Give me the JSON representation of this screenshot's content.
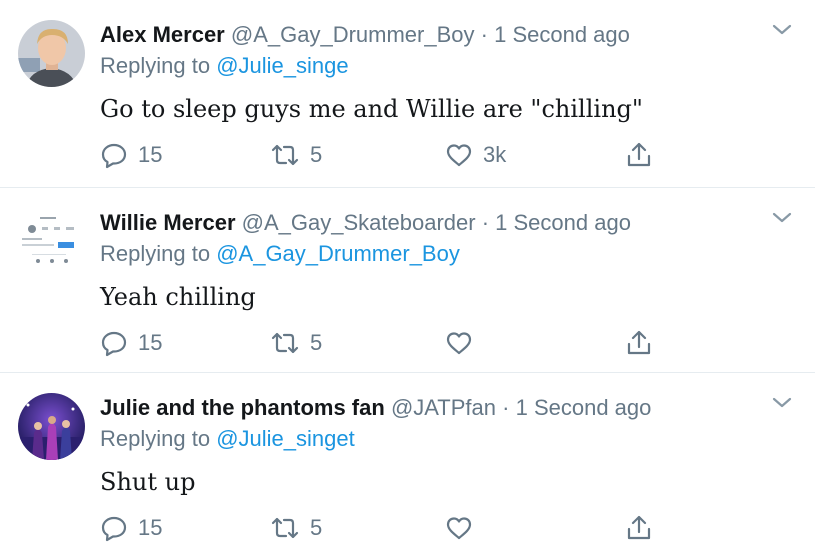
{
  "tweets": [
    {
      "name": "Alex Mercer",
      "handle": "@A_Gay_Drummer_Boy",
      "time": "1 Second ago",
      "replying_prefix": "Replying to",
      "replying_to": "@Julie_singe",
      "text": "Go to sleep guys me and Willie are \"chilling\"",
      "replies": "15",
      "retweets": "5",
      "likes": "3k"
    },
    {
      "name": "Willie Mercer",
      "handle": "@A_Gay_Skateboarder",
      "time": "1 Second ago",
      "replying_prefix": "Replying to",
      "replying_to": "@A_Gay_Drummer_Boy",
      "text": "Yeah chilling",
      "replies": "15",
      "retweets": "5",
      "likes": ""
    },
    {
      "name": "Julie and the phantoms fan",
      "handle": "@JATPfan",
      "time": "1 Second ago",
      "replying_prefix": "Replying to",
      "replying_to": "@Julie_singet",
      "text": "Shut up",
      "replies": "15",
      "retweets": "5",
      "likes": ""
    }
  ],
  "separator": "·",
  "icons": {
    "reply": "reply-icon",
    "retweet": "retweet-icon",
    "like": "heart-icon",
    "share": "share-icon",
    "menu": "chevron-down-icon"
  },
  "colors": {
    "name": "#14171a",
    "muted": "#657786",
    "link": "#1b95e0",
    "divider": "#e6ecf0"
  }
}
